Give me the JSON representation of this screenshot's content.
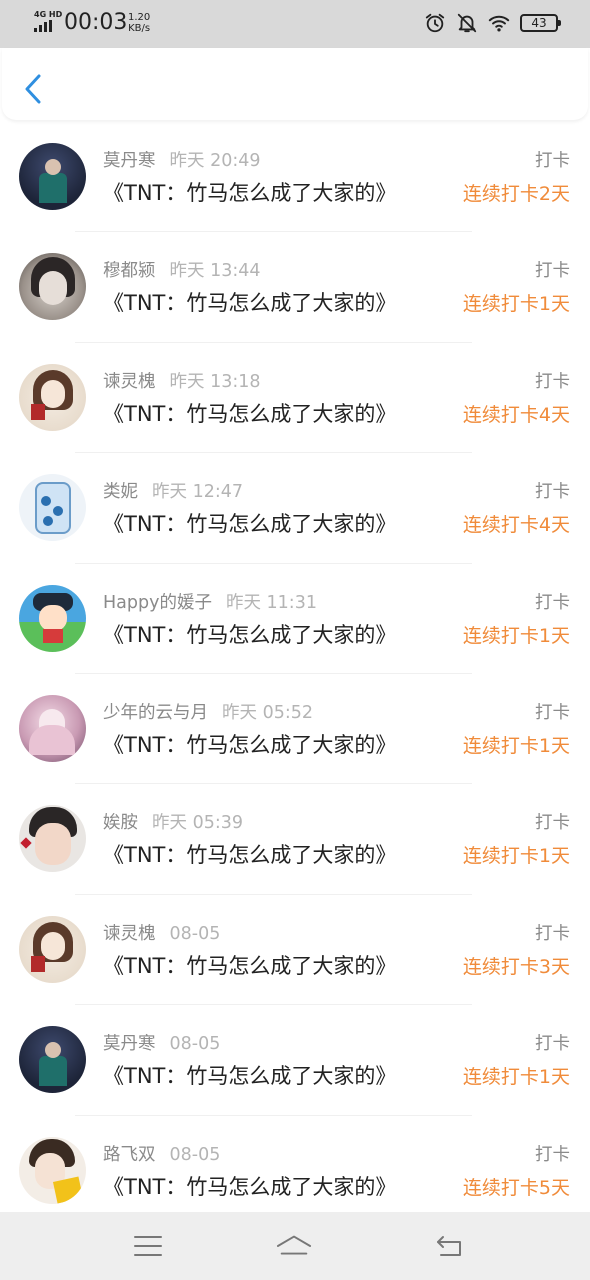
{
  "status_bar": {
    "network": "4G HD",
    "time": "00:03",
    "speed_value": "1.20",
    "speed_unit": "KB/s",
    "battery": "43"
  },
  "header": {
    "back_icon": "chevron-left-icon"
  },
  "colors": {
    "accent": "#f08b3a",
    "back": "#2f8fe0"
  },
  "items": [
    {
      "name": "莫丹寒",
      "time": "昨天 20:49",
      "title": "《TNT：竹马怎么成了大家的》",
      "type": "打卡",
      "streak": "连续打卡2天"
    },
    {
      "name": "穆都颍",
      "time": "昨天 13:44",
      "title": "《TNT：竹马怎么成了大家的》",
      "type": "打卡",
      "streak": "连续打卡1天"
    },
    {
      "name": "谏灵槐",
      "time": "昨天 13:18",
      "title": "《TNT：竹马怎么成了大家的》",
      "type": "打卡",
      "streak": "连续打卡4天"
    },
    {
      "name": "类妮",
      "time": "昨天 12:47",
      "title": "《TNT：竹马怎么成了大家的》",
      "type": "打卡",
      "streak": "连续打卡4天"
    },
    {
      "name": "Happy的媛子",
      "time": "昨天 11:31",
      "title": "《TNT：竹马怎么成了大家的》",
      "type": "打卡",
      "streak": "连续打卡1天"
    },
    {
      "name": "少年的云与月",
      "time": "昨天 05:52",
      "title": "《TNT：竹马怎么成了大家的》",
      "type": "打卡",
      "streak": "连续打卡1天"
    },
    {
      "name": "娭胺",
      "time": "昨天 05:39",
      "title": "《TNT：竹马怎么成了大家的》",
      "type": "打卡",
      "streak": "连续打卡1天"
    },
    {
      "name": "谏灵槐",
      "time": "08-05",
      "title": "《TNT：竹马怎么成了大家的》",
      "type": "打卡",
      "streak": "连续打卡3天"
    },
    {
      "name": "莫丹寒",
      "time": "08-05",
      "title": "《TNT：竹马怎么成了大家的》",
      "type": "打卡",
      "streak": "连续打卡1天"
    },
    {
      "name": "路飞双",
      "time": "08-05",
      "title": "《TNT：竹马怎么成了大家的》",
      "type": "打卡",
      "streak": "连续打卡5天"
    }
  ],
  "nav": {
    "menu_icon": "menu-icon",
    "home_icon": "home-icon",
    "back_icon": "back-arrow-icon"
  }
}
